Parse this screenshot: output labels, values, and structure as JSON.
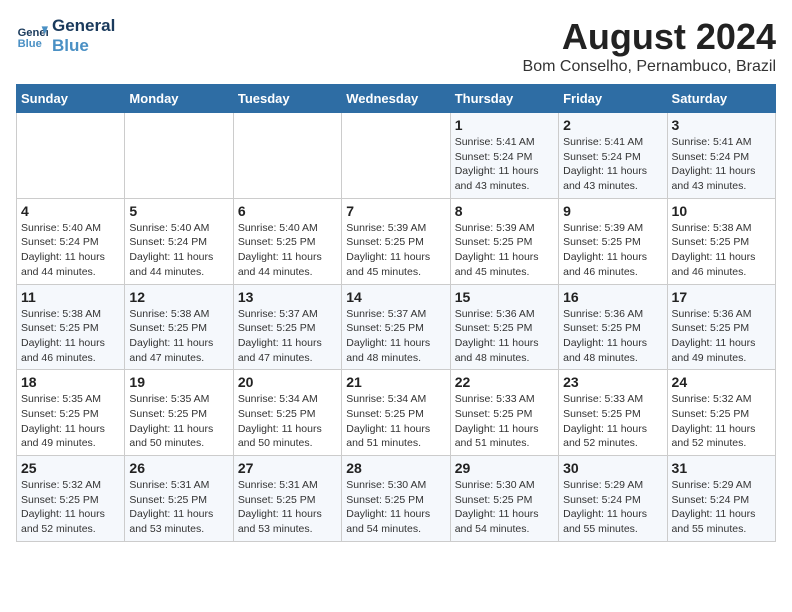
{
  "logo": {
    "line1": "General",
    "line2": "Blue"
  },
  "title": "August 2024",
  "subtitle": "Bom Conselho, Pernambuco, Brazil",
  "days_of_week": [
    "Sunday",
    "Monday",
    "Tuesday",
    "Wednesday",
    "Thursday",
    "Friday",
    "Saturday"
  ],
  "weeks": [
    [
      {
        "day": "",
        "info": ""
      },
      {
        "day": "",
        "info": ""
      },
      {
        "day": "",
        "info": ""
      },
      {
        "day": "",
        "info": ""
      },
      {
        "day": "1",
        "info": "Sunrise: 5:41 AM\nSunset: 5:24 PM\nDaylight: 11 hours\nand 43 minutes."
      },
      {
        "day": "2",
        "info": "Sunrise: 5:41 AM\nSunset: 5:24 PM\nDaylight: 11 hours\nand 43 minutes."
      },
      {
        "day": "3",
        "info": "Sunrise: 5:41 AM\nSunset: 5:24 PM\nDaylight: 11 hours\nand 43 minutes."
      }
    ],
    [
      {
        "day": "4",
        "info": "Sunrise: 5:40 AM\nSunset: 5:24 PM\nDaylight: 11 hours\nand 44 minutes."
      },
      {
        "day": "5",
        "info": "Sunrise: 5:40 AM\nSunset: 5:24 PM\nDaylight: 11 hours\nand 44 minutes."
      },
      {
        "day": "6",
        "info": "Sunrise: 5:40 AM\nSunset: 5:25 PM\nDaylight: 11 hours\nand 44 minutes."
      },
      {
        "day": "7",
        "info": "Sunrise: 5:39 AM\nSunset: 5:25 PM\nDaylight: 11 hours\nand 45 minutes."
      },
      {
        "day": "8",
        "info": "Sunrise: 5:39 AM\nSunset: 5:25 PM\nDaylight: 11 hours\nand 45 minutes."
      },
      {
        "day": "9",
        "info": "Sunrise: 5:39 AM\nSunset: 5:25 PM\nDaylight: 11 hours\nand 46 minutes."
      },
      {
        "day": "10",
        "info": "Sunrise: 5:38 AM\nSunset: 5:25 PM\nDaylight: 11 hours\nand 46 minutes."
      }
    ],
    [
      {
        "day": "11",
        "info": "Sunrise: 5:38 AM\nSunset: 5:25 PM\nDaylight: 11 hours\nand 46 minutes."
      },
      {
        "day": "12",
        "info": "Sunrise: 5:38 AM\nSunset: 5:25 PM\nDaylight: 11 hours\nand 47 minutes."
      },
      {
        "day": "13",
        "info": "Sunrise: 5:37 AM\nSunset: 5:25 PM\nDaylight: 11 hours\nand 47 minutes."
      },
      {
        "day": "14",
        "info": "Sunrise: 5:37 AM\nSunset: 5:25 PM\nDaylight: 11 hours\nand 48 minutes."
      },
      {
        "day": "15",
        "info": "Sunrise: 5:36 AM\nSunset: 5:25 PM\nDaylight: 11 hours\nand 48 minutes."
      },
      {
        "day": "16",
        "info": "Sunrise: 5:36 AM\nSunset: 5:25 PM\nDaylight: 11 hours\nand 48 minutes."
      },
      {
        "day": "17",
        "info": "Sunrise: 5:36 AM\nSunset: 5:25 PM\nDaylight: 11 hours\nand 49 minutes."
      }
    ],
    [
      {
        "day": "18",
        "info": "Sunrise: 5:35 AM\nSunset: 5:25 PM\nDaylight: 11 hours\nand 49 minutes."
      },
      {
        "day": "19",
        "info": "Sunrise: 5:35 AM\nSunset: 5:25 PM\nDaylight: 11 hours\nand 50 minutes."
      },
      {
        "day": "20",
        "info": "Sunrise: 5:34 AM\nSunset: 5:25 PM\nDaylight: 11 hours\nand 50 minutes."
      },
      {
        "day": "21",
        "info": "Sunrise: 5:34 AM\nSunset: 5:25 PM\nDaylight: 11 hours\nand 51 minutes."
      },
      {
        "day": "22",
        "info": "Sunrise: 5:33 AM\nSunset: 5:25 PM\nDaylight: 11 hours\nand 51 minutes."
      },
      {
        "day": "23",
        "info": "Sunrise: 5:33 AM\nSunset: 5:25 PM\nDaylight: 11 hours\nand 52 minutes."
      },
      {
        "day": "24",
        "info": "Sunrise: 5:32 AM\nSunset: 5:25 PM\nDaylight: 11 hours\nand 52 minutes."
      }
    ],
    [
      {
        "day": "25",
        "info": "Sunrise: 5:32 AM\nSunset: 5:25 PM\nDaylight: 11 hours\nand 52 minutes."
      },
      {
        "day": "26",
        "info": "Sunrise: 5:31 AM\nSunset: 5:25 PM\nDaylight: 11 hours\nand 53 minutes."
      },
      {
        "day": "27",
        "info": "Sunrise: 5:31 AM\nSunset: 5:25 PM\nDaylight: 11 hours\nand 53 minutes."
      },
      {
        "day": "28",
        "info": "Sunrise: 5:30 AM\nSunset: 5:25 PM\nDaylight: 11 hours\nand 54 minutes."
      },
      {
        "day": "29",
        "info": "Sunrise: 5:30 AM\nSunset: 5:25 PM\nDaylight: 11 hours\nand 54 minutes."
      },
      {
        "day": "30",
        "info": "Sunrise: 5:29 AM\nSunset: 5:24 PM\nDaylight: 11 hours\nand 55 minutes."
      },
      {
        "day": "31",
        "info": "Sunrise: 5:29 AM\nSunset: 5:24 PM\nDaylight: 11 hours\nand 55 minutes."
      }
    ]
  ]
}
